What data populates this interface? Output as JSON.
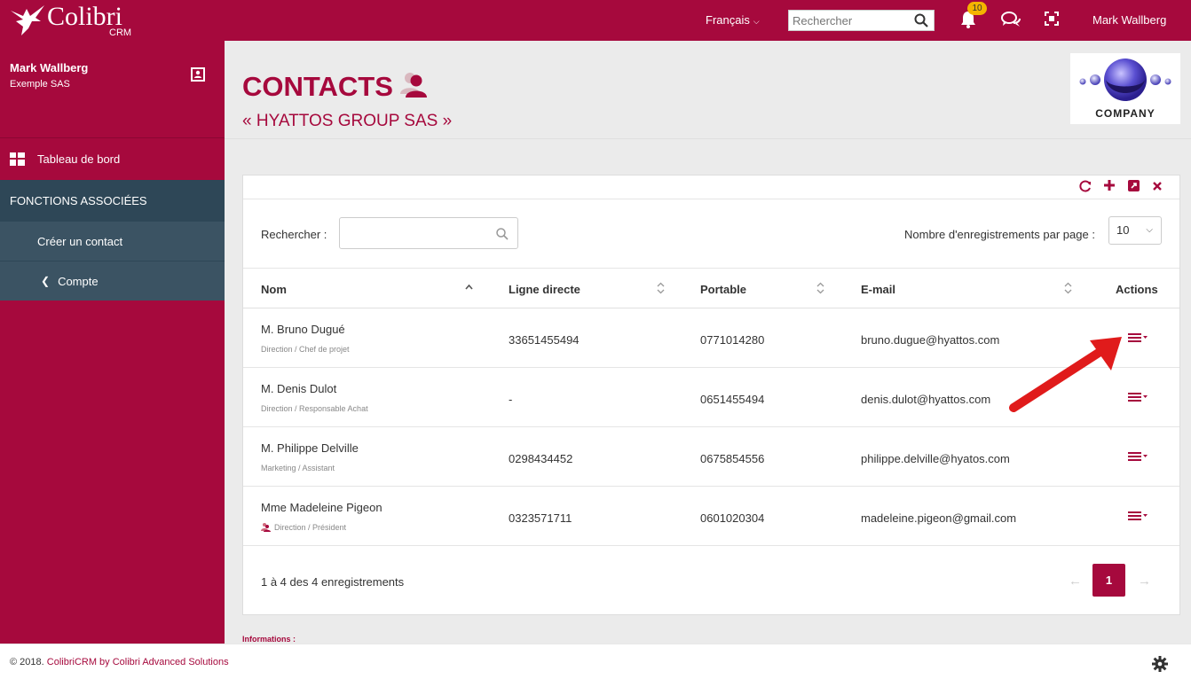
{
  "brand": {
    "name": "Colibri",
    "sub": "CRM"
  },
  "topbar": {
    "language": "Français",
    "search_placeholder": "Rechercher",
    "notifications_count": "10",
    "user_name": "Mark Wallberg"
  },
  "sidebar": {
    "user_name": "Mark Wallberg",
    "company": "Exemple SAS",
    "dashboard_label": "Tableau de bord",
    "section_header": "FONCTIONS ASSOCIÉES",
    "items": [
      {
        "label": "Créer un contact"
      },
      {
        "label": "Compte"
      }
    ]
  },
  "header": {
    "title": "CONTACTS",
    "subtitle": "« HYATTOS GROUP SAS »",
    "company_logo_text": "COMPANY"
  },
  "table": {
    "search_label": "Rechercher :",
    "per_page_label": "Nombre d'enregistrements par page :",
    "per_page_value": "10",
    "columns": {
      "name": "Nom",
      "phone": "Ligne directe",
      "mobile": "Portable",
      "email": "E-mail",
      "actions": "Actions"
    },
    "rows": [
      {
        "name": "M. Bruno Dugué",
        "role": "Direction / Chef de projet",
        "phone": "33651455494",
        "mobile": "0771014280",
        "email": "bruno.dugue@hyattos.com",
        "has_icon": false
      },
      {
        "name": "M. Denis Dulot",
        "role": "Direction / Responsable Achat",
        "phone": "-",
        "mobile": "0651455494",
        "email": "denis.dulot@hyattos.com",
        "has_icon": false
      },
      {
        "name": "M. Philippe Delville",
        "role": "Marketing / Assistant",
        "phone": "0298434452",
        "mobile": "0675854556",
        "email": "philippe.delville@hyatos.com",
        "has_icon": false
      },
      {
        "name": "Mme Madeleine Pigeon",
        "role": "Direction / Président",
        "phone": "0323571711",
        "mobile": "0601020304",
        "email": "madeleine.pigeon@gmail.com",
        "has_icon": true
      }
    ],
    "info": "1 à 4 des 4 enregistrements",
    "pagination": {
      "prev": "←",
      "current": "1",
      "next": "→"
    }
  },
  "info_label": "Informations :",
  "footer": {
    "copyright_prefix": "© 2018.",
    "copyright_brand": "ColibriCRM by Colibri Advanced Solutions"
  },
  "colors": {
    "brand": "#a6093d",
    "sidebar_section": "#2e4757",
    "sidebar_sub": "#3b5363",
    "badge": "#f4b400",
    "arrow": "#e01b1b"
  }
}
